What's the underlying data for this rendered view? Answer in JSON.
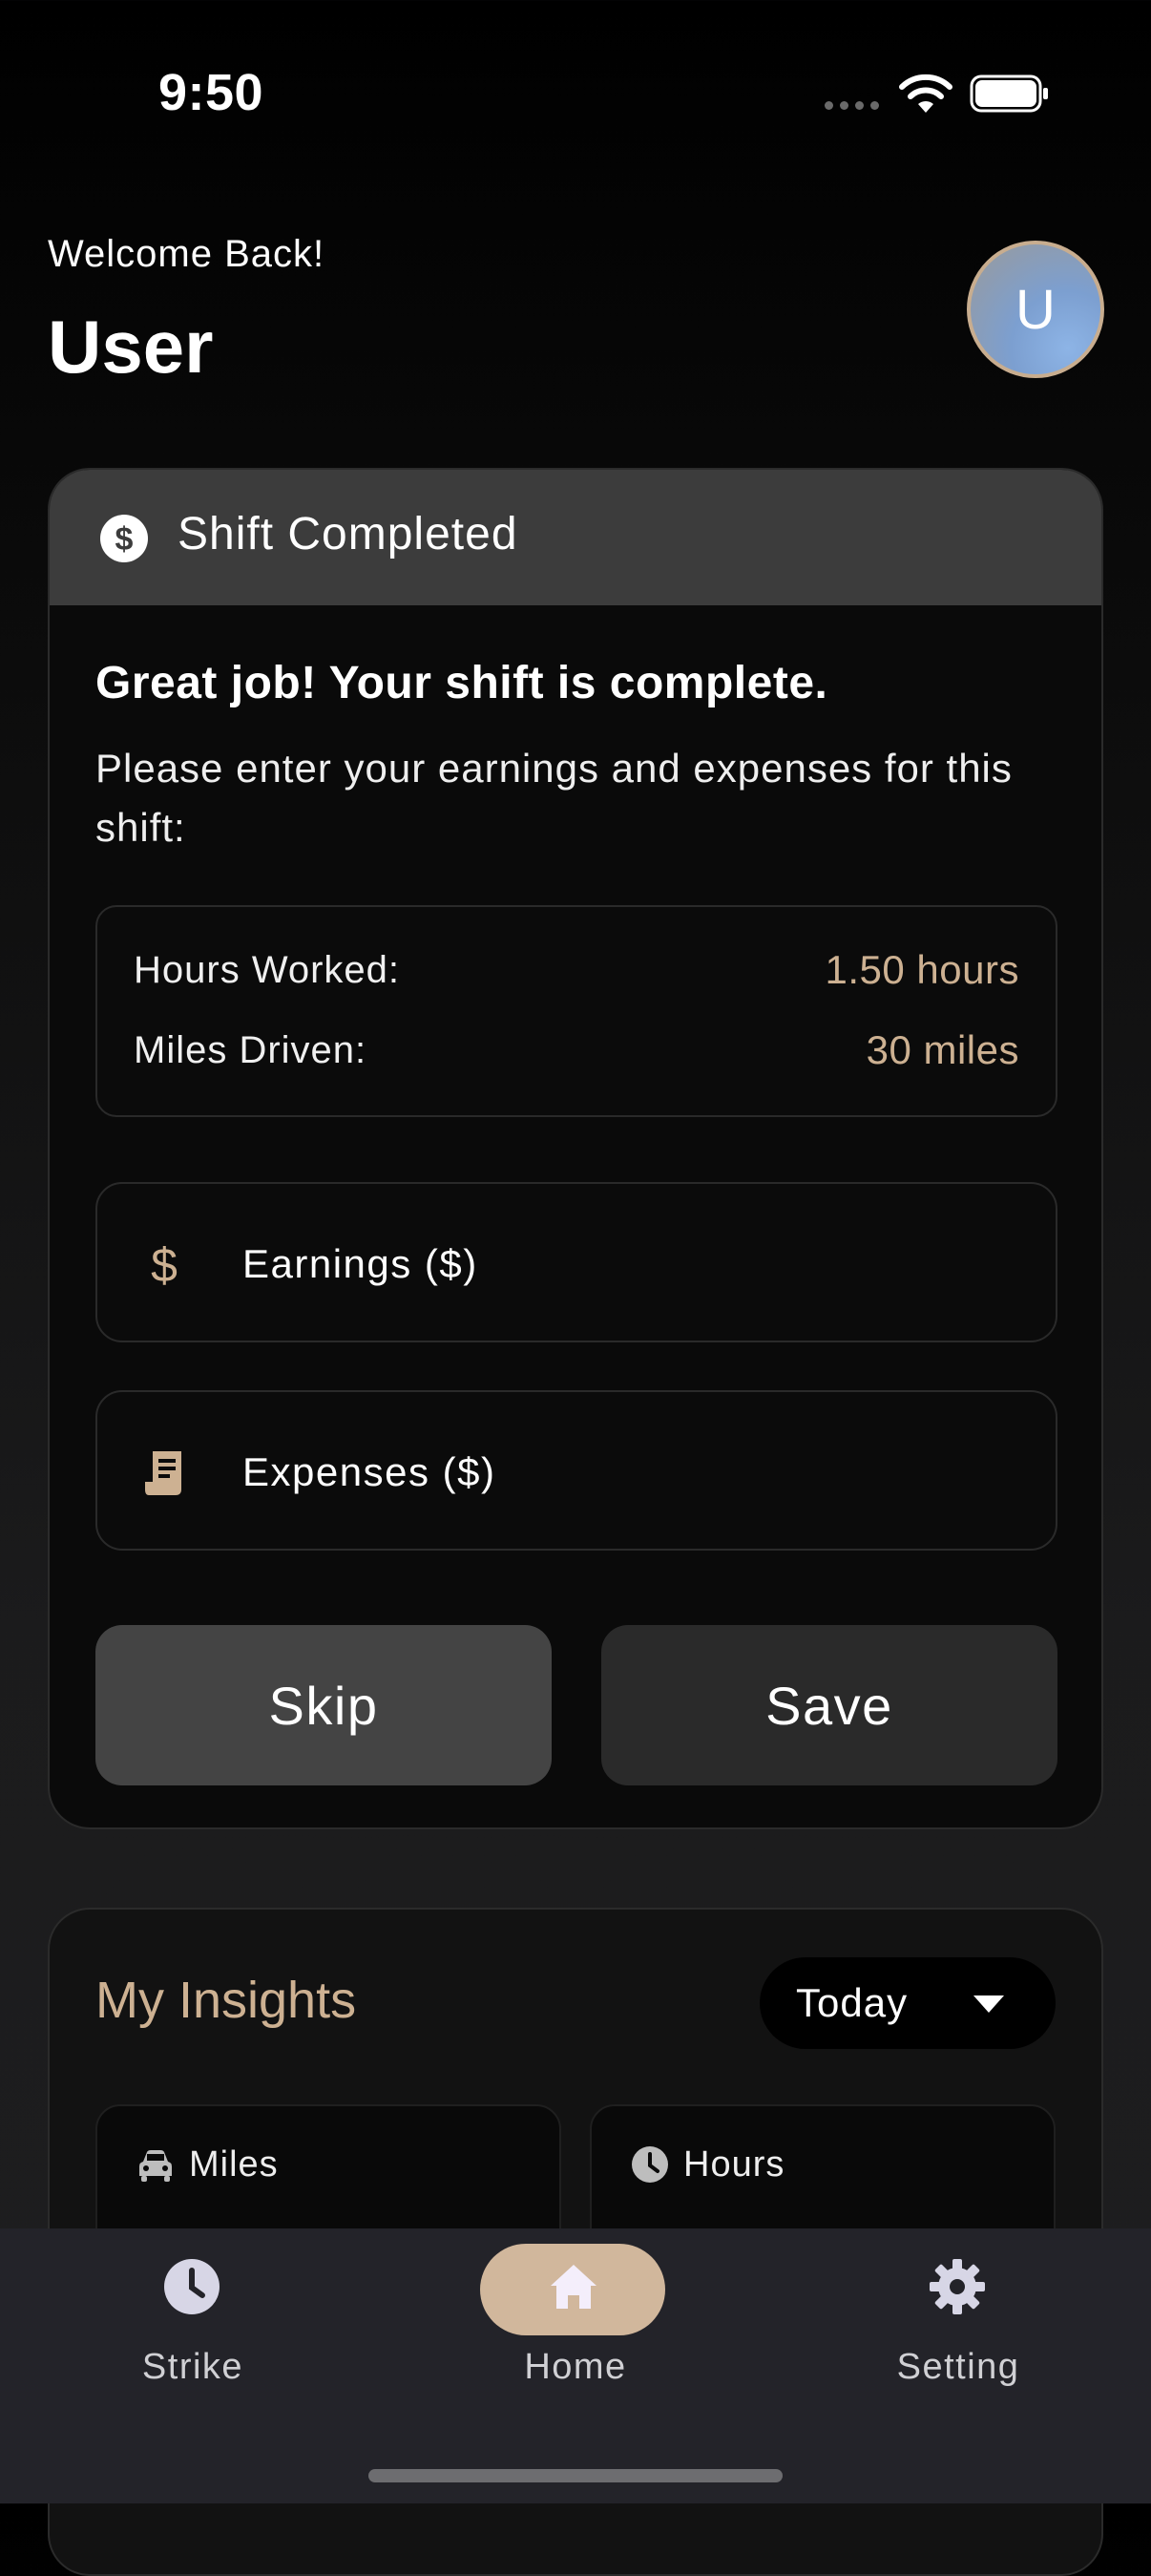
{
  "status_bar": {
    "time": "9:50"
  },
  "header": {
    "greeting": "Welcome Back!",
    "username": "User",
    "avatar_initial": "U"
  },
  "shift_card": {
    "title": "Shift Completed",
    "headline": "Great job! Your shift is complete.",
    "instructions": "Please enter your earnings and expenses for this shift:",
    "stats": [
      {
        "label": "Hours Worked:",
        "value": "1.50 hours"
      },
      {
        "label": "Miles Driven:",
        "value": "30 miles"
      }
    ],
    "earnings_placeholder": "Earnings ($)",
    "expenses_placeholder": "Expenses ($)",
    "skip_label": "Skip",
    "save_label": "Save"
  },
  "insights": {
    "title": "My Insights",
    "period": "Today",
    "cards": [
      {
        "label": "Miles",
        "icon": "car-icon"
      },
      {
        "label": "Hours",
        "icon": "clock-icon"
      }
    ]
  },
  "bottom_nav": {
    "items": [
      {
        "label": "Strike",
        "icon": "clock-icon"
      },
      {
        "label": "Home",
        "icon": "home-icon",
        "active": true
      },
      {
        "label": "Setting",
        "icon": "gear-icon"
      }
    ]
  },
  "colors": {
    "accent": "#cdb192",
    "nav_active": "#d1b79c",
    "card_header": "#3c3c3c",
    "skip_button": "#444444",
    "save_button": "#2a2a2a"
  }
}
